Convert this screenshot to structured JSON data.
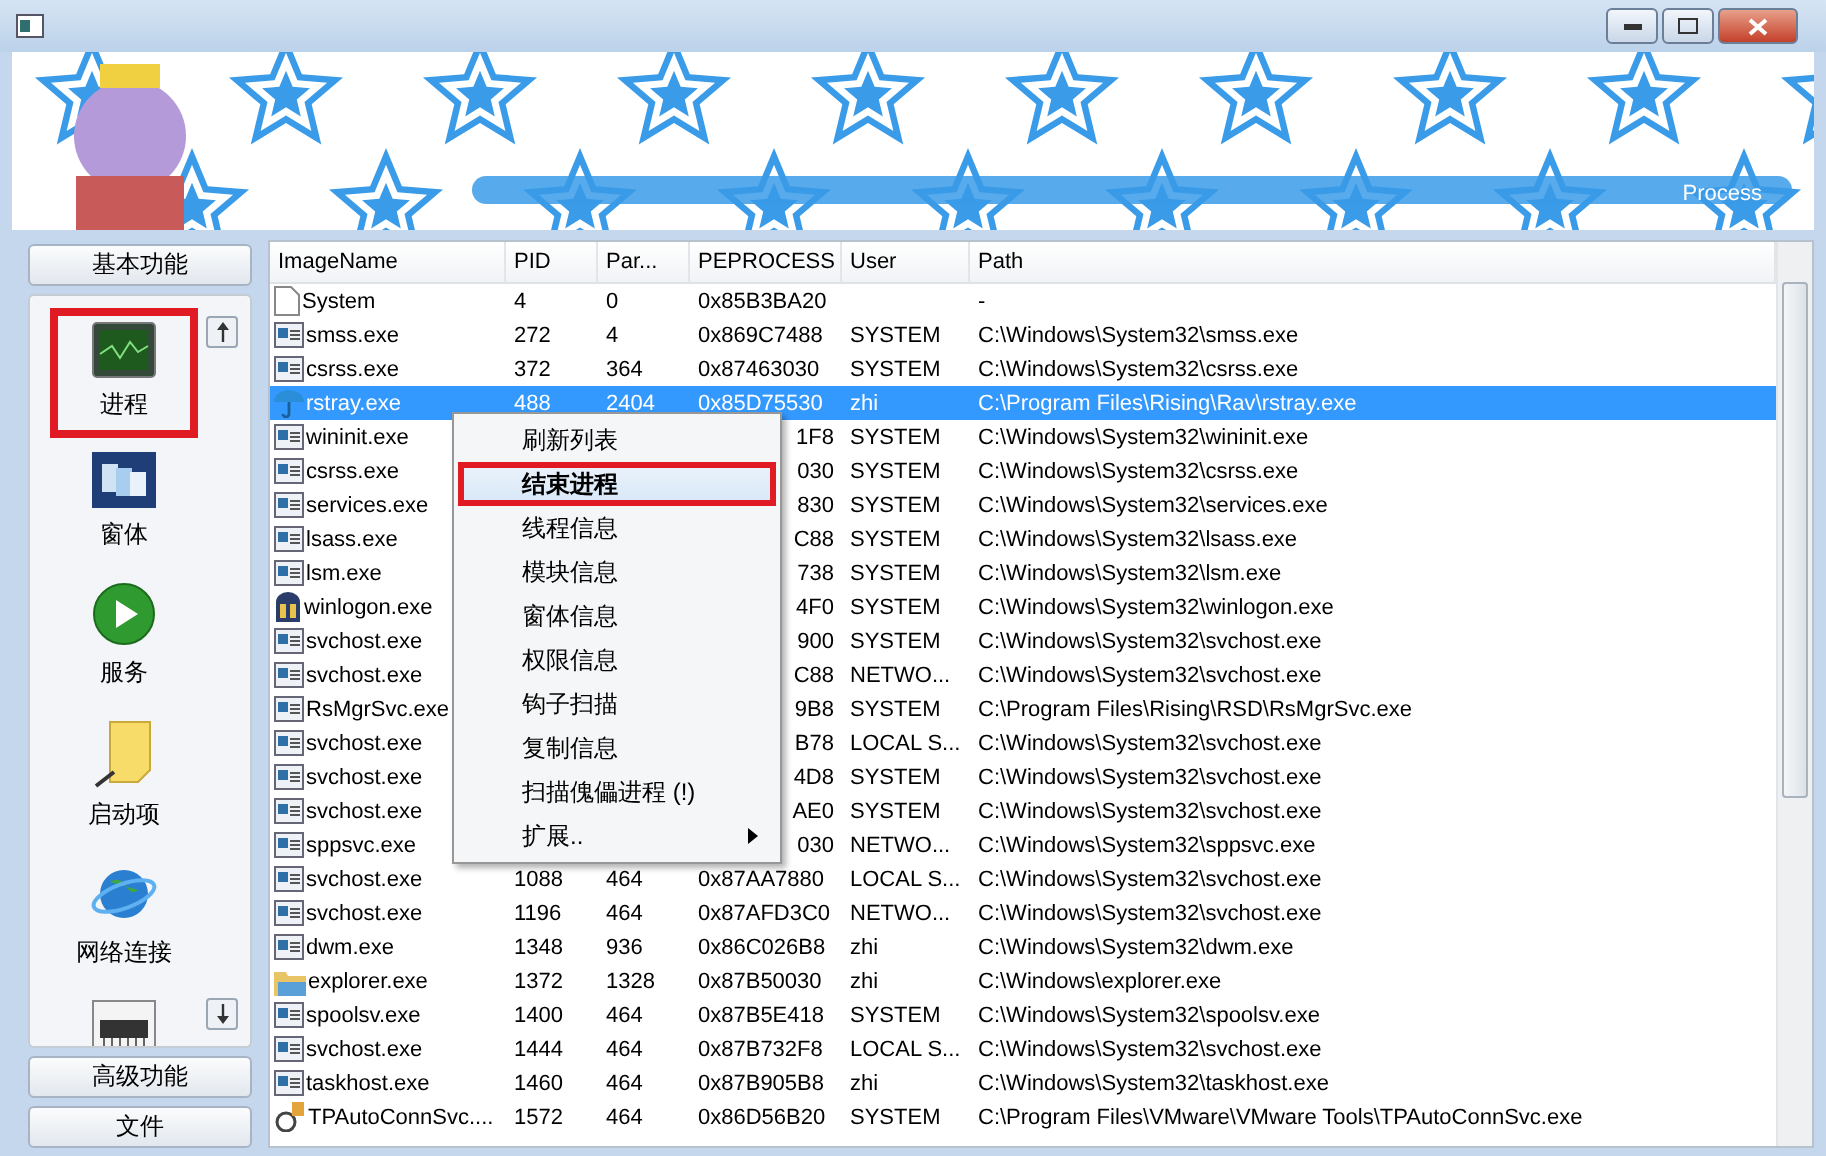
{
  "banner": {
    "caption": "Process"
  },
  "sidebar": {
    "groups": [
      {
        "label": "基本功能"
      },
      {
        "label": "高级功能"
      },
      {
        "label": "文件"
      }
    ],
    "items": [
      {
        "label": "进程",
        "kind": "monitor",
        "annotated": true
      },
      {
        "label": "窗体",
        "kind": "windows",
        "annotated": false
      },
      {
        "label": "服务",
        "kind": "play",
        "annotated": false
      },
      {
        "label": "启动项",
        "kind": "note",
        "annotated": false
      },
      {
        "label": "网络连接",
        "kind": "globe",
        "annotated": false
      },
      {
        "kind": "chip",
        "annotated": false
      }
    ]
  },
  "table": {
    "columns": [
      "ImageName",
      "PID",
      "Par...",
      "PEPROCESS",
      "User",
      "Path"
    ],
    "rows": [
      {
        "kind": "blank",
        "name": "System",
        "pid": "4",
        "ppid": "0",
        "peprocess": "0x85B3BA20",
        "path": "-",
        "selected": false
      },
      {
        "kind": "exe",
        "name": "smss.exe",
        "pid": "272",
        "ppid": "4",
        "peprocess": "0x869C7488",
        "user": "SYSTEM",
        "path": "C:\\Windows\\System32\\smss.exe",
        "selected": false
      },
      {
        "kind": "exe",
        "name": "csrss.exe",
        "pid": "372",
        "ppid": "364",
        "peprocess": "0x87463030",
        "user": "SYSTEM",
        "path": "C:\\Windows\\System32\\csrss.exe",
        "selected": false
      },
      {
        "kind": "umbrella",
        "name": "rstray.exe",
        "pid": "488",
        "ppid": "2404",
        "peprocess": "0x85D75530",
        "user": "zhi",
        "path": "C:\\Program Files\\Rising\\Rav\\rstray.exe",
        "selected": true
      },
      {
        "kind": "exe",
        "name": "wininit.exe",
        "peprocess": "1F8",
        "user": "SYSTEM",
        "path": "C:\\Windows\\System32\\wininit.exe",
        "selected": false
      },
      {
        "kind": "exe",
        "name": "csrss.exe",
        "peprocess": "030",
        "user": "SYSTEM",
        "path": "C:\\Windows\\System32\\csrss.exe",
        "selected": false
      },
      {
        "kind": "exe",
        "name": "services.exe",
        "peprocess": "830",
        "user": "SYSTEM",
        "path": "C:\\Windows\\System32\\services.exe",
        "selected": false
      },
      {
        "kind": "exe",
        "name": "lsass.exe",
        "peprocess": "C88",
        "user": "SYSTEM",
        "path": "C:\\Windows\\System32\\lsass.exe",
        "selected": false
      },
      {
        "kind": "exe",
        "name": "lsm.exe",
        "peprocess": "738",
        "user": "SYSTEM",
        "path": "C:\\Windows\\System32\\lsm.exe",
        "selected": false
      },
      {
        "kind": "castle",
        "name": "winlogon.exe",
        "peprocess": "4F0",
        "user": "SYSTEM",
        "path": "C:\\Windows\\System32\\winlogon.exe",
        "selected": false
      },
      {
        "kind": "exe",
        "name": "svchost.exe",
        "peprocess": "900",
        "user": "SYSTEM",
        "path": "C:\\Windows\\System32\\svchost.exe",
        "selected": false
      },
      {
        "kind": "exe",
        "name": "svchost.exe",
        "peprocess": "C88",
        "user": "NETWO...",
        "path": "C:\\Windows\\System32\\svchost.exe",
        "selected": false
      },
      {
        "kind": "exe",
        "name": "RsMgrSvc.exe",
        "peprocess": "9B8",
        "user": "SYSTEM",
        "path": "C:\\Program Files\\Rising\\RSD\\RsMgrSvc.exe",
        "selected": false
      },
      {
        "kind": "exe",
        "name": "svchost.exe",
        "peprocess": "B78",
        "user": "LOCAL S...",
        "path": "C:\\Windows\\System32\\svchost.exe",
        "selected": false
      },
      {
        "kind": "exe",
        "name": "svchost.exe",
        "peprocess": "4D8",
        "user": "SYSTEM",
        "path": "C:\\Windows\\System32\\svchost.exe",
        "selected": false
      },
      {
        "kind": "exe",
        "name": "svchost.exe",
        "peprocess": "AE0",
        "user": "SYSTEM",
        "path": "C:\\Windows\\System32\\svchost.exe",
        "selected": false
      },
      {
        "kind": "exe",
        "name": "sppsvc.exe",
        "peprocess": "030",
        "user": "NETWO...",
        "path": "C:\\Windows\\System32\\sppsvc.exe",
        "selected": false
      },
      {
        "kind": "exe",
        "name": "svchost.exe",
        "pid": "1088",
        "ppid": "464",
        "peprocess": "0x87AA7880",
        "user": "LOCAL S...",
        "path": "C:\\Windows\\System32\\svchost.exe",
        "selected": false
      },
      {
        "kind": "exe",
        "name": "svchost.exe",
        "pid": "1196",
        "ppid": "464",
        "peprocess": "0x87AFD3C0",
        "user": "NETWO...",
        "path": "C:\\Windows\\System32\\svchost.exe",
        "selected": false
      },
      {
        "kind": "exe",
        "name": "dwm.exe",
        "pid": "1348",
        "ppid": "936",
        "peprocess": "0x86C026B8",
        "user": "zhi",
        "path": "C:\\Windows\\System32\\dwm.exe",
        "selected": false
      },
      {
        "kind": "folder",
        "name": "explorer.exe",
        "pid": "1372",
        "ppid": "1328",
        "peprocess": "0x87B50030",
        "user": "zhi",
        "path": "C:\\Windows\\explorer.exe",
        "selected": false
      },
      {
        "kind": "exe",
        "name": "spoolsv.exe",
        "pid": "1400",
        "ppid": "464",
        "peprocess": "0x87B5E418",
        "user": "SYSTEM",
        "path": "C:\\Windows\\System32\\spoolsv.exe",
        "selected": false
      },
      {
        "kind": "exe",
        "name": "svchost.exe",
        "pid": "1444",
        "ppid": "464",
        "peprocess": "0x87B732F8",
        "user": "LOCAL S...",
        "path": "C:\\Windows\\System32\\svchost.exe",
        "selected": false
      },
      {
        "kind": "exe",
        "name": "taskhost.exe",
        "pid": "1460",
        "ppid": "464",
        "peprocess": "0x87B905B8",
        "user": "zhi",
        "path": "C:\\Windows\\System32\\taskhost.exe",
        "selected": false
      },
      {
        "kind": "service",
        "name": "TPAutoConnSvc....",
        "pid": "1572",
        "ppid": "464",
        "peprocess": "0x86D56B20",
        "user": "SYSTEM",
        "path": "C:\\Program Files\\VMware\\VMware Tools\\TPAutoConnSvc.exe",
        "selected": false
      }
    ]
  },
  "context_menu": {
    "items": [
      {
        "label": "刷新列表",
        "selected": false,
        "annotated": false,
        "has_submenu": false
      },
      {
        "label": "结束进程",
        "selected": true,
        "annotated": true,
        "has_submenu": false
      },
      {
        "label": "线程信息",
        "selected": false,
        "annotated": false,
        "has_submenu": false
      },
      {
        "label": "模块信息",
        "selected": false,
        "annotated": false,
        "has_submenu": false
      },
      {
        "label": "窗体信息",
        "selected": false,
        "annotated": false,
        "has_submenu": false
      },
      {
        "label": "权限信息",
        "selected": false,
        "annotated": false,
        "has_submenu": false
      },
      {
        "label": "钩子扫描",
        "selected": false,
        "annotated": false,
        "has_submenu": false
      },
      {
        "label": "复制信息",
        "selected": false,
        "annotated": false,
        "has_submenu": false
      },
      {
        "label": "扫描傀儡进程 (!)",
        "selected": false,
        "annotated": false,
        "has_submenu": false
      },
      {
        "label": "扩展..",
        "selected": false,
        "annotated": false,
        "has_submenu": true
      }
    ]
  }
}
